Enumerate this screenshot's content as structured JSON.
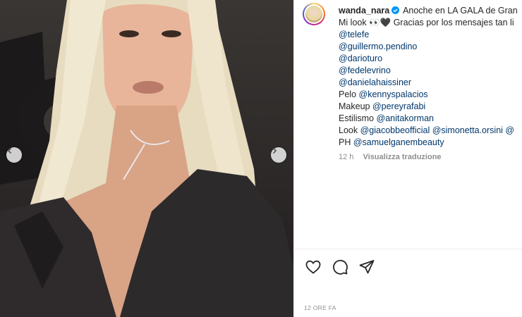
{
  "post": {
    "username": "wanda_nara",
    "caption_first": "Anoche en LA GALA de Gran",
    "caption_second_prefix": "Mi look",
    "caption_emoji": "👀🖤",
    "caption_second_suffix": "Gracias por los mensajes tan li",
    "mentions_block": [
      "@telefe",
      "@guillermo.pendino",
      "@darioturo",
      "@fedelevrino",
      "@danielahaissiner"
    ],
    "credits": [
      {
        "label": "Pelo",
        "handles": "@kennyspalacios"
      },
      {
        "label": "Makeup",
        "handles": "@pereyrafabi"
      },
      {
        "label": "Estilismo",
        "handles": "@anitakorman"
      },
      {
        "label": "Look",
        "handles": "@giacobbeofficial @simonetta.orsini @"
      },
      {
        "label": "PH",
        "handles": "@samuelganembeauty"
      }
    ],
    "age": "12 h",
    "translate_label": "Visualizza traduzione",
    "timestamp": "12 ORE FA"
  },
  "icons": [
    "chevron-left-icon",
    "chevron-right-icon",
    "heart-icon",
    "comment-icon",
    "share-icon",
    "verified-badge-icon"
  ],
  "colors": {
    "link": "#00376b",
    "muted": "#8e8e8e",
    "verified": "#0095f6"
  }
}
